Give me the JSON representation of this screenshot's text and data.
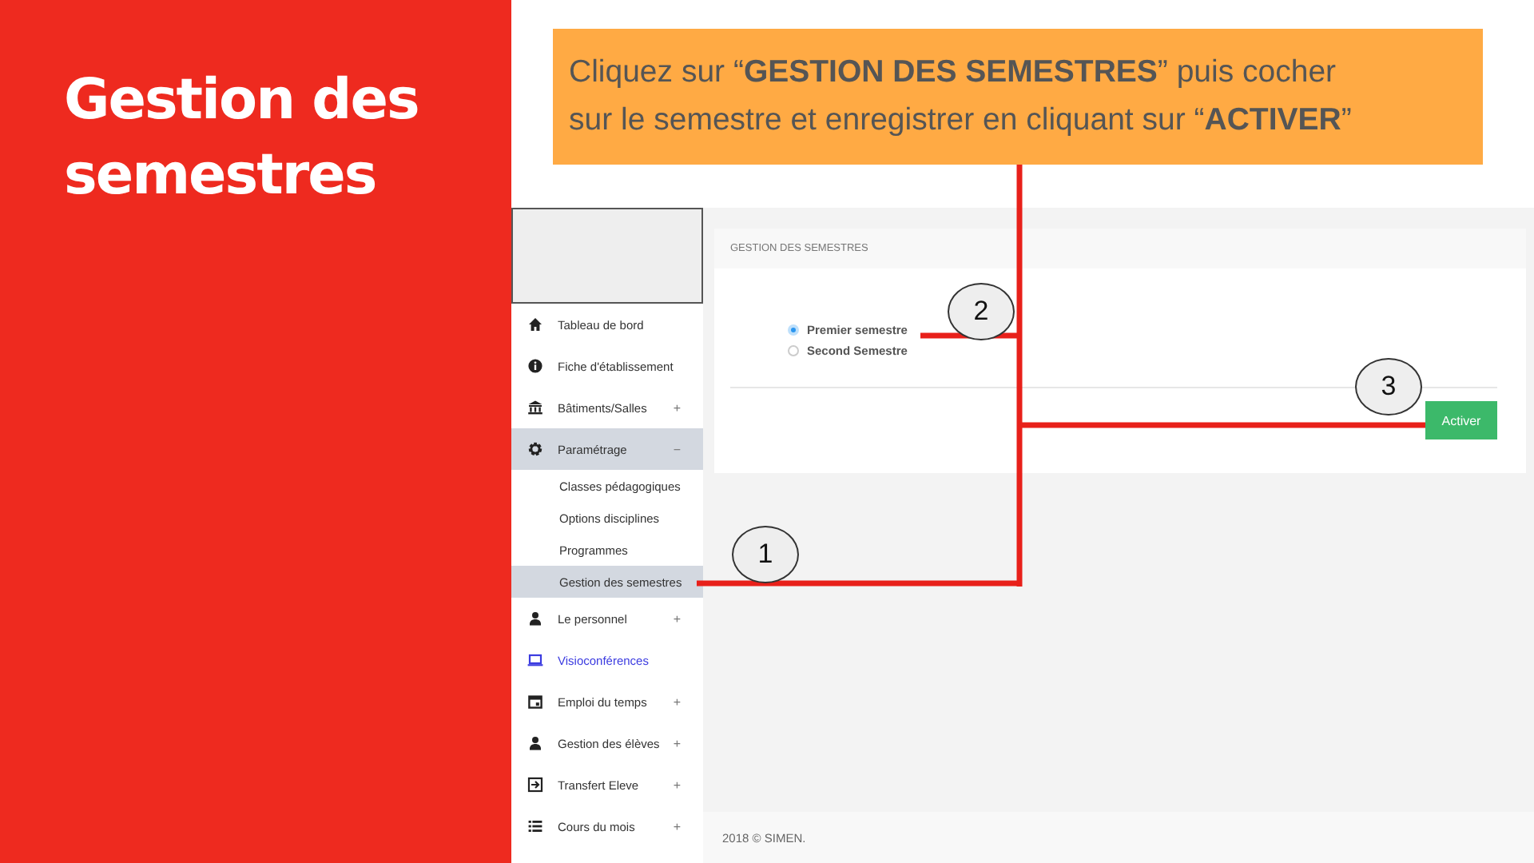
{
  "slide": {
    "title": "Gestion des semestres",
    "callout": "Cliquez sur “**GESTION DES SEMESTRES**” puis cocher sur le semestre et enregistrer en cliquant sur “**ACTIVER**”"
  },
  "sidebar": {
    "items": [
      {
        "label": "Tableau de bord",
        "selected": false
      },
      {
        "label": "Fiche d'établissement",
        "selected": false
      },
      {
        "label": "Bâtiments/Salles",
        "sign": "+",
        "selected": false
      },
      {
        "label": "Paramétrage",
        "sign": "−",
        "selected": true,
        "children": [
          {
            "label": "Classes pédagogiques",
            "selected": false
          },
          {
            "label": "Options disciplines",
            "selected": false
          },
          {
            "label": "Programmes",
            "selected": false
          },
          {
            "label": "Gestion des semestres",
            "selected": true
          }
        ]
      },
      {
        "label": "Le personnel",
        "sign": "+",
        "selected": false
      },
      {
        "label": "Visioconférences",
        "selected": false,
        "active": true
      },
      {
        "label": "Emploi du temps",
        "sign": "+",
        "selected": false
      },
      {
        "label": "Gestion des élèves",
        "sign": "+",
        "selected": false
      },
      {
        "label": "Transfert Eleve",
        "sign": "+",
        "selected": false
      },
      {
        "label": "Cours du mois",
        "sign": "+",
        "selected": false
      }
    ]
  },
  "panel": {
    "title": "GESTION DES SEMESTRES",
    "options": [
      {
        "label": "Premier semestre",
        "selected": true
      },
      {
        "label": "Second Semestre",
        "selected": false
      }
    ],
    "button": "Activer"
  },
  "footer": "2018 © SIMEN.",
  "steps": [
    "1",
    "2",
    "3"
  ]
}
